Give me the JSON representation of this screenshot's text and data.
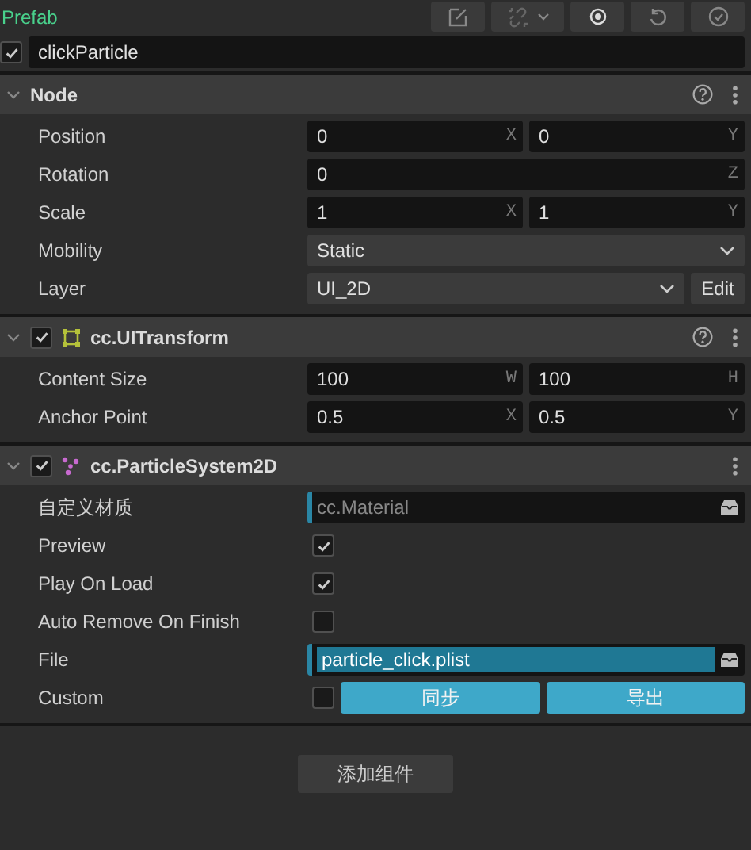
{
  "prefab_label": "Prefab",
  "node": {
    "enabled": true,
    "name": "clickParticle"
  },
  "sections": [
    {
      "title": "Node",
      "help": true,
      "rows": [
        {
          "kind": "vec",
          "label": "Position",
          "fields": [
            {
              "value": "0",
              "axis": "X"
            },
            {
              "value": "0",
              "axis": "Y"
            }
          ]
        },
        {
          "kind": "vec",
          "label": "Rotation",
          "fields": [
            {
              "value": "0",
              "axis": "Z"
            }
          ]
        },
        {
          "kind": "vec",
          "label": "Scale",
          "fields": [
            {
              "value": "1",
              "axis": "X"
            },
            {
              "value": "1",
              "axis": "Y"
            }
          ]
        },
        {
          "kind": "select",
          "label": "Mobility",
          "value": "Static"
        },
        {
          "kind": "select",
          "label": "Layer",
          "value": "UI_2D",
          "button": "Edit"
        }
      ]
    },
    {
      "title": "cc.UITransform",
      "checkbox": true,
      "help": true,
      "rows": [
        {
          "kind": "vec",
          "label": "Content Size",
          "fields": [
            {
              "value": "100",
              "axis": "W"
            },
            {
              "value": "100",
              "axis": "H"
            }
          ]
        },
        {
          "kind": "vec",
          "label": "Anchor Point",
          "fields": [
            {
              "value": "0.5",
              "axis": "X"
            },
            {
              "value": "0.5",
              "axis": "Y"
            }
          ]
        }
      ]
    },
    {
      "title": "cc.ParticleSystem2D",
      "checkbox": true,
      "help": false,
      "rows": [
        {
          "kind": "asset",
          "label": "自定义材质",
          "placeholder": "cc.Material"
        },
        {
          "kind": "check",
          "label": "Preview",
          "checked": true
        },
        {
          "kind": "check",
          "label": "Play On Load",
          "checked": true
        },
        {
          "kind": "check",
          "label": "Auto Remove On Finish",
          "checked": false
        },
        {
          "kind": "asset",
          "label": "File",
          "value": "particle_click.plist"
        },
        {
          "kind": "check",
          "label": "Custom",
          "checked": false,
          "buttons": [
            "同步",
            "导出"
          ]
        }
      ]
    }
  ],
  "add_component": "添加组件"
}
